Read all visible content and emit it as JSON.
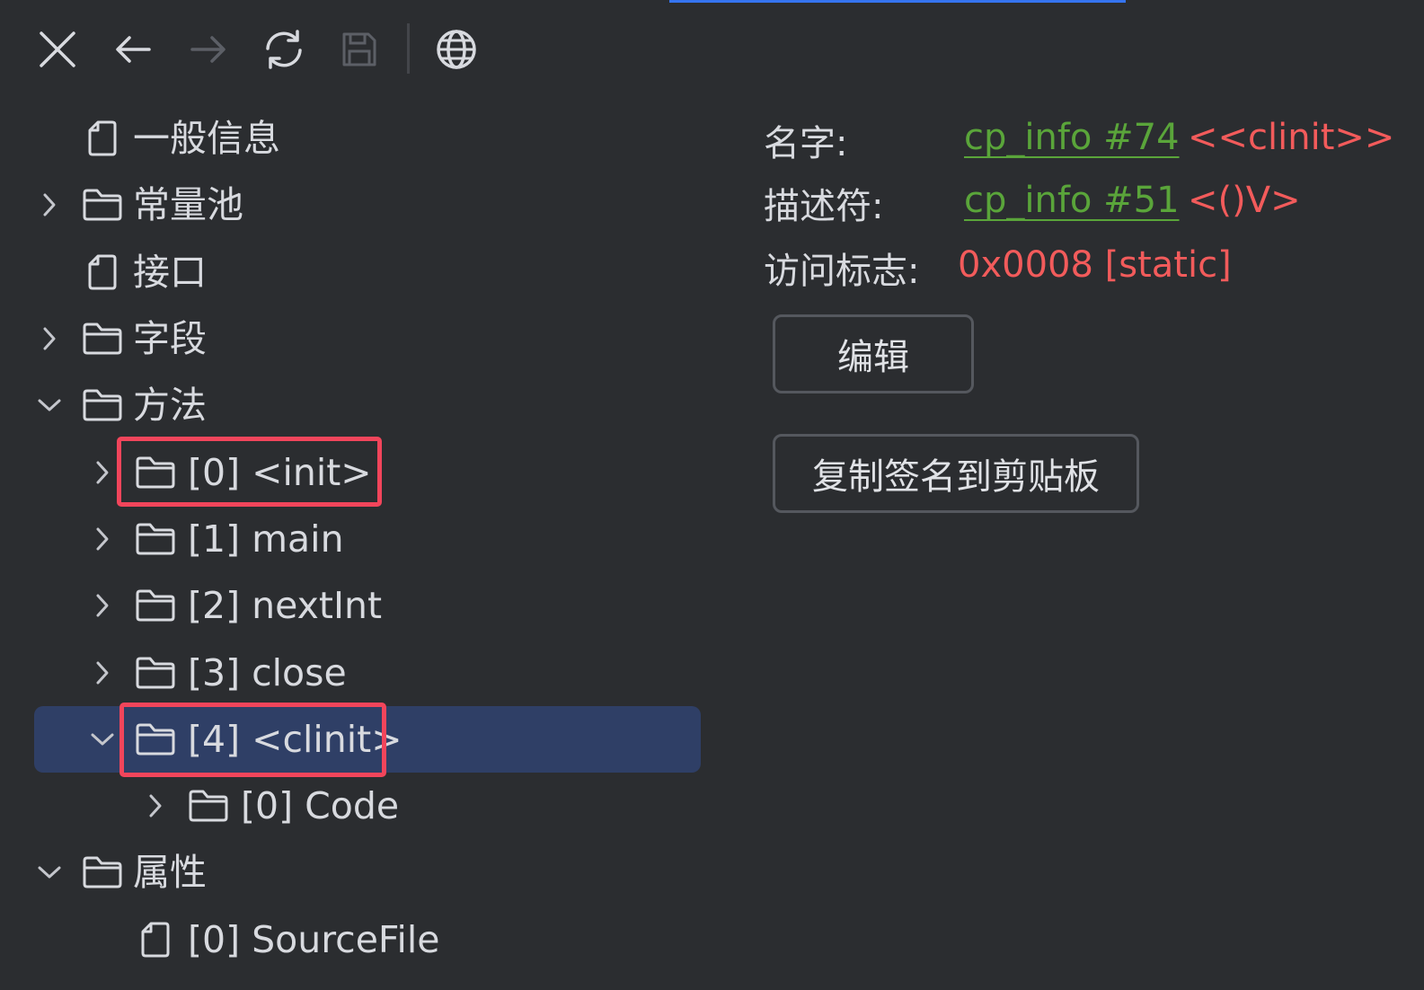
{
  "toolbar": {
    "close_icon": "close-icon",
    "back_icon": "arrow-left-icon",
    "forward_icon": "arrow-right-icon",
    "refresh_icon": "refresh-icon",
    "save_icon": "save-icon",
    "web_icon": "globe-icon"
  },
  "tree": {
    "items": [
      {
        "label": "一般信息",
        "kind": "file"
      },
      {
        "label": "常量池",
        "kind": "folder",
        "state": "collapsed"
      },
      {
        "label": "接口",
        "kind": "file"
      },
      {
        "label": "字段",
        "kind": "folder",
        "state": "collapsed"
      },
      {
        "label": "方法",
        "kind": "folder",
        "state": "expanded"
      },
      {
        "label": "[0] <init>",
        "kind": "folder",
        "state": "collapsed"
      },
      {
        "label": "[1] main",
        "kind": "folder",
        "state": "collapsed"
      },
      {
        "label": "[2] nextInt",
        "kind": "folder",
        "state": "collapsed"
      },
      {
        "label": "[3] close",
        "kind": "folder",
        "state": "collapsed"
      },
      {
        "label": "[4] <clinit>",
        "kind": "folder",
        "state": "expanded",
        "selected": true
      },
      {
        "label": "[0] Code",
        "kind": "folder",
        "state": "collapsed"
      },
      {
        "label": "属性",
        "kind": "folder",
        "state": "expanded"
      },
      {
        "label": "[0] SourceFile",
        "kind": "file"
      }
    ]
  },
  "detail": {
    "name_label": "名字:",
    "name_link": "cp_info #74",
    "name_value": "<<clinit>>",
    "descriptor_label": "描述符:",
    "descriptor_link": "cp_info #51",
    "descriptor_value": "<()V>",
    "access_label": "访问标志:",
    "access_value": "0x0008 [static]",
    "edit_button": "编辑",
    "copy_button": "复制签名到剪贴板"
  },
  "colors": {
    "background": "#2b2d30",
    "selection": "#2f3f66",
    "link": "#5aa53a",
    "value_red": "#f25b5b",
    "highlight_box": "#f2455b",
    "accent": "#3574f0"
  }
}
